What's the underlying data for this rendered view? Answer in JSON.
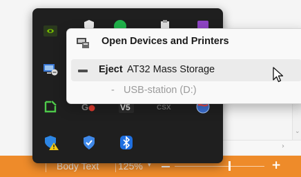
{
  "context_menu": {
    "open_devices_label": "Open Devices and Printers",
    "eject_prefix": "Eject",
    "eject_device": "AT32 Mass Storage",
    "volume_dash": "-",
    "volume_label": "USB-station (D:)"
  },
  "status_bar": {
    "paragraph_style": "Body Text",
    "zoom_value": "125%",
    "zoom_caret": "▾",
    "zoom_out": "−",
    "zoom_in": "+",
    "zoom_slider_fraction": 0.61
  },
  "tray_icons": [
    "nvidia-icon",
    "shield-check-icon",
    "green-circle-icon",
    "clipboard-icon",
    "purple-app-icon",
    "network-drive-icon",
    "green-snip-icon",
    "gc-icon",
    "v5-app-icon",
    "csx-app-icon",
    "globe-icon",
    "security-warning-icon",
    "defender-shield-icon",
    "bluetooth-icon"
  ],
  "colors": {
    "status_bar": "#ee8b2a",
    "flyout_bg": "#1f1f1f",
    "menu_bg": "#f9f9f9",
    "menu_hover": "#ebebeb",
    "volume_text": "#9b9b9b"
  }
}
